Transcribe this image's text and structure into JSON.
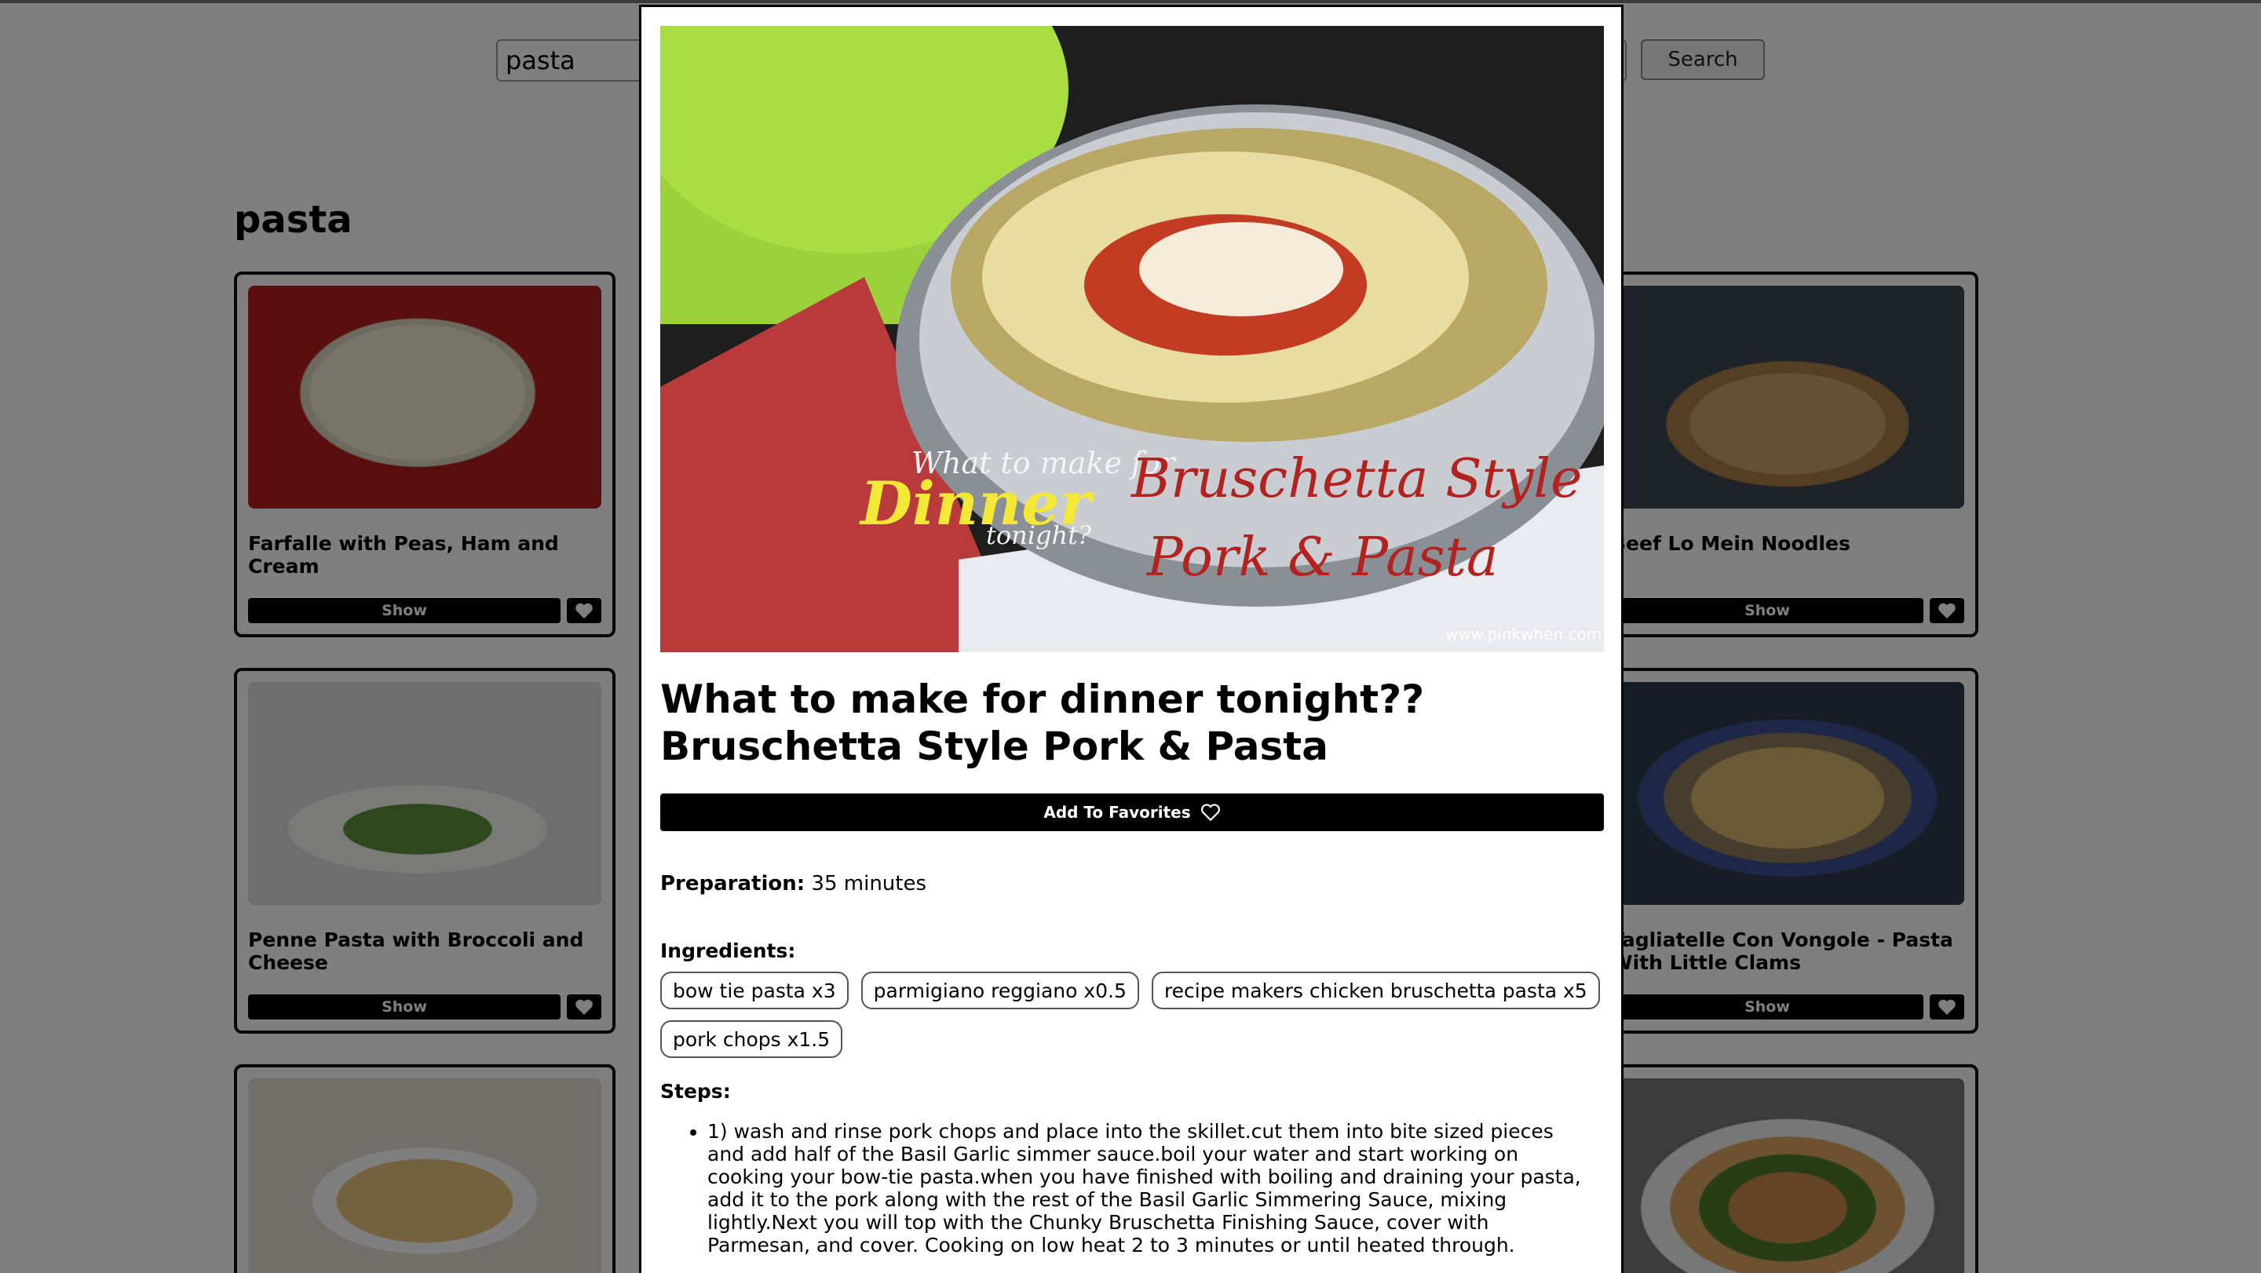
{
  "search": {
    "value": "pasta",
    "button_label": "Search"
  },
  "results_title": "pasta",
  "cards": [
    {
      "name": "Farfalle with Peas, Ham and Cream",
      "show_label": "Show"
    },
    {
      "name": "Beef Lo Mein Noodles",
      "show_label": "Show"
    },
    {
      "name": "Penne Pasta with Broccoli and Cheese",
      "show_label": "Show"
    },
    {
      "name": "Tagliatelle Con Vongole - Pasta With Little Clams",
      "show_label": "Show"
    }
  ],
  "modal": {
    "image_overlay": {
      "line1": "What to make for",
      "line2": "Dinner",
      "line3": "tonight?",
      "brand1": "Bruschetta Style",
      "brand2": "Pork & Pasta",
      "url": "www.pinkwhen.com"
    },
    "title": "What to make for dinner tonight?? Bruschetta Style Pork & Pasta",
    "add_favorites_label": "Add To Favorites",
    "preparation_label": "Preparation:",
    "preparation_value": "35 minutes",
    "ingredients_label": "Ingredients:",
    "ingredients": [
      "bow tie pasta x3",
      "parmigiano reggiano x0.5",
      "recipe makers chicken bruschetta pasta x5",
      "pork chops x1.5"
    ],
    "steps_label": "Steps:",
    "steps": [
      "1) wash and rinse pork chops and place into the skillet.cut them into bite sized pieces and add half of the Basil Garlic simmer sauce.boil your water and start working on cooking your bow-tie pasta.when you have finished with boiling and draining your pasta, add it to the pork along with the rest of the Basil Garlic Simmering Sauce, mixing lightly.Next you will top with the Chunky Bruschetta Finishing Sauce, cover with Parmesan, and cover. Cooking on low heat 2 to 3 minutes or until heated through."
    ]
  }
}
